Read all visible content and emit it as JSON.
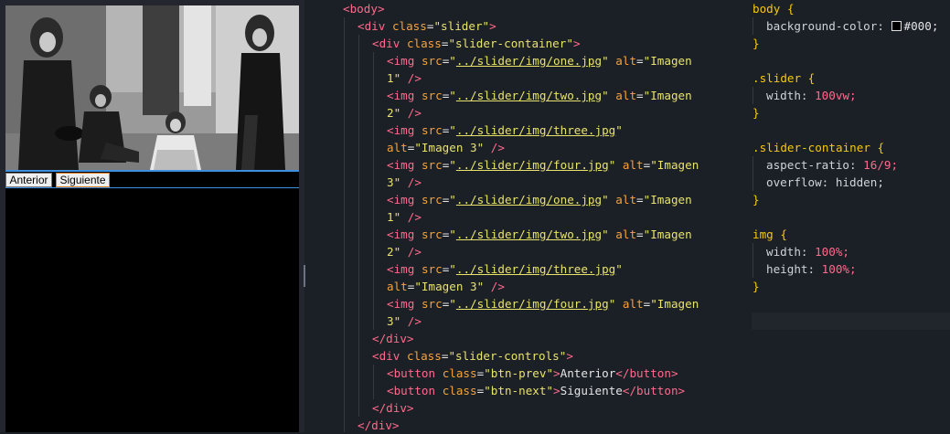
{
  "preview": {
    "prev_label": "Anterior",
    "next_label": "Siguiente",
    "background": "#000000",
    "accent": "#3d8fe0"
  },
  "html_code": {
    "body_open": "body",
    "div_open": "div",
    "cls": "class",
    "src": "src",
    "alt": "alt",
    "img": "img",
    "button": "button",
    "slider": "\"slider\"",
    "slider_container": "\"slider-container\"",
    "slider_controls": "\"slider-controls\"",
    "btn_prev": "\"btn-prev\"",
    "btn_next": "\"btn-next\"",
    "path1": "../slider/img/one.jpg",
    "path2": "../slider/img/two.jpg",
    "path3": "../slider/img/three.jpg",
    "path4": "../slider/img/four.jpg",
    "alt_imagen": "\"Imagen",
    "alt_1": "1\"",
    "alt_2": "2\"",
    "alt_3_full": "\"Imagen 3\"",
    "alt_4": "3\"",
    "btn_prev_text": "Anterior",
    "btn_next_text": "Siguiente"
  },
  "css_code": {
    "body_sel": "body",
    "bg_prop": "background-color:",
    "bg_val": "#000;",
    "slider_sel": ".slider",
    "width_prop": "width:",
    "width_val": "100vw;",
    "container_sel": ".slider-container",
    "aspect_prop": "aspect-ratio:",
    "aspect_val": "16/9;",
    "overflow_prop": "overflow:",
    "overflow_val": "hidden;",
    "img_sel": "img",
    "img_width_prop": "width:",
    "img_width_val": "100%;",
    "img_height_prop": "height:",
    "img_height_val": "100%;"
  }
}
